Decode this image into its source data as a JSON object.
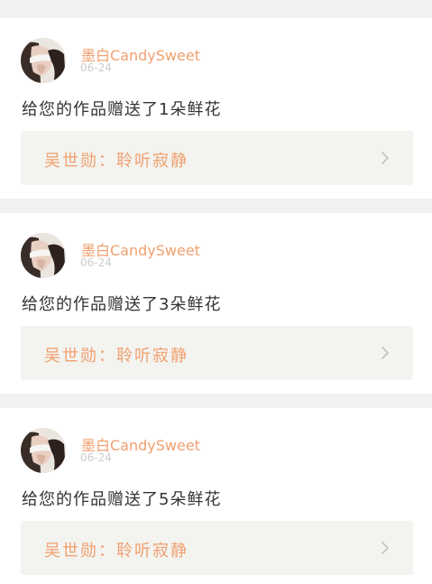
{
  "feed": {
    "items": [
      {
        "user": "墨白CandySweet",
        "date": "06-24",
        "message": "给您的作品赠送了1朵鲜花",
        "work": "吴世勋：聆听寂静",
        "avatar_icon": "avatar-image",
        "arrow_icon": "chevron-right-icon"
      },
      {
        "user": "墨白CandySweet",
        "date": "06-24",
        "message": "给您的作品赠送了3朵鲜花",
        "work": "吴世勋：聆听寂静",
        "avatar_icon": "avatar-image",
        "arrow_icon": "chevron-right-icon"
      },
      {
        "user": "墨白CandySweet",
        "date": "06-24",
        "message": "给您的作品赠送了5朵鲜花",
        "work": "吴世勋：聆听寂静",
        "avatar_icon": "avatar-image",
        "arrow_icon": "chevron-right-icon"
      }
    ]
  },
  "colors": {
    "accent": "#f0a070",
    "text": "#333333",
    "muted": "#cccccc",
    "card_bg": "#ffffff",
    "link_bg": "#f3f3ef",
    "page_bg": "#f2f2f2"
  }
}
